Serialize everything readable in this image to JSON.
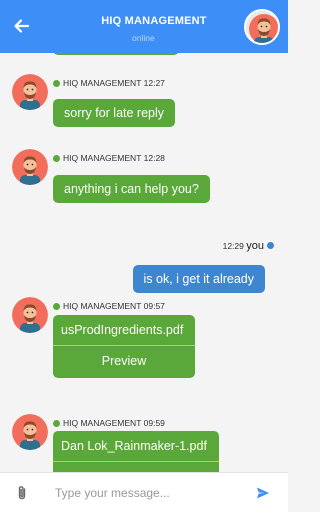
{
  "header": {
    "title": "HIQ MANAGEMENT",
    "status": "online",
    "back_icon": "arrow-left-icon",
    "accent": "#3e8ef7"
  },
  "colors": {
    "incoming_bubble": "#5aa839",
    "outgoing_bubble": "#3f86d0",
    "background": "#f4f4f4"
  },
  "messages": [
    {
      "sender": "HIQ MANAGEMENT",
      "time": "12:27",
      "text": "sorry for late reply"
    },
    {
      "sender": "HIQ MANAGEMENT",
      "time": "12:28",
      "text": "anything i can help you?"
    },
    {
      "sender": "you",
      "time": "12:29",
      "text": "is ok, i get it already"
    },
    {
      "sender": "HIQ MANAGEMENT",
      "time": "09:57",
      "file_name": "usProdIngredients.pdf",
      "action": "Preview"
    },
    {
      "sender": "HIQ MANAGEMENT",
      "time": "09:59",
      "file_name": "Dan Lok_Rainmaker-1.pdf"
    }
  ],
  "composer": {
    "placeholder": "Type your message...",
    "attach_icon": "paperclip-icon",
    "send_icon": "send-icon"
  }
}
